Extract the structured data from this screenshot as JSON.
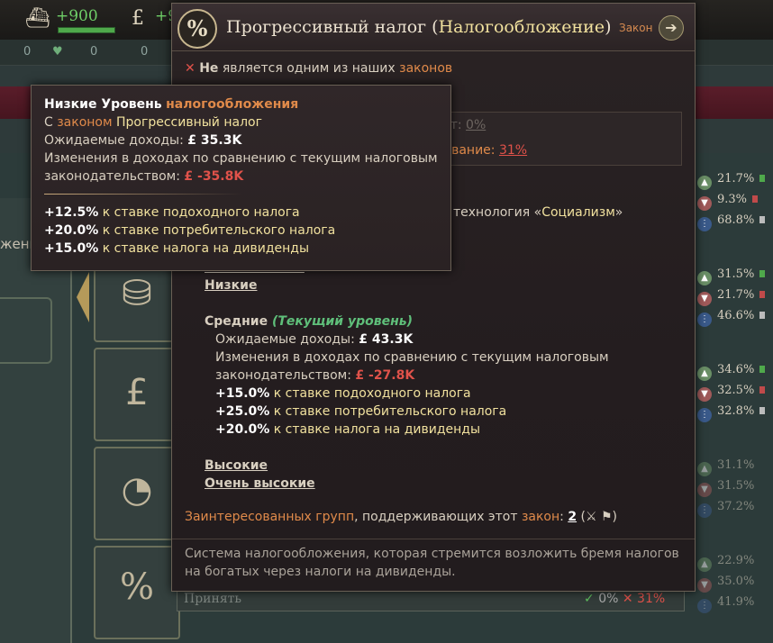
{
  "topbar": {
    "income": "+900",
    "second_value": "+9"
  },
  "subbar": {
    "stat1": "0",
    "stat2": "0",
    "stat3": "0",
    "stat4": "0"
  },
  "left_panel": {
    "partial_text": "жени"
  },
  "votes": [
    {
      "yes": "21.7%",
      "no": "9.3%",
      "abstain": "68.8%"
    },
    {
      "yes": "31.5%",
      "no": "21.7%",
      "abstain": "46.6%"
    },
    {
      "yes": "34.6%",
      "no": "32.5%",
      "abstain": "32.8%"
    },
    {
      "yes": "31.1%",
      "no": "31.5%",
      "abstain": "37.2%"
    },
    {
      "yes": "22.9%",
      "no": "35.0%",
      "abstain": "41.9%"
    }
  ],
  "bottom": {
    "accept_label": "Принять",
    "yes_pct": "0%",
    "no_pct": "31%"
  },
  "law": {
    "icon": "%",
    "name": "Прогрессивный налог",
    "group": "Налогообложение",
    "type_label": "Закон",
    "not_prefix": "Не",
    "not_middle": "является одним из наших",
    "not_link": "законов",
    "underbox_line1_pre": "ст:",
    "underbox_line1_val": "0%",
    "underbox_line2_pre": "ивание:",
    "underbox_line2_val": "31%",
    "tech_pre": "технология «",
    "tech_name": "Социализм",
    "tech_post": "»"
  },
  "levels": {
    "very_low_partial": "Очень низкие",
    "low": "Низкие",
    "medium": "Средние",
    "current_tag": "(Текущий уровень)",
    "expected_label": "Ожидаемые доходы:",
    "expected_value": "£ 43.3K",
    "change_label1": "Изменения в доходах по сравнению с текущим налоговым",
    "change_label2": "законодательством:",
    "change_value": "£ -27.8K",
    "rates": [
      {
        "value": "+15.0%",
        "text": "к ставке подоходного налога"
      },
      {
        "value": "+25.0%",
        "text": "к ставке потребительского налога"
      },
      {
        "value": "+20.0%",
        "text": "к ставке налога на дивиденды"
      }
    ],
    "high": "Высокие",
    "very_high": "Очень высокие"
  },
  "igs": {
    "pre": "Заинтересованных групп",
    "mid": ", поддерживающих этот ",
    "law_word": "закон",
    "colon": ":",
    "count": "2",
    "icons": "(⚔ ⚑)"
  },
  "description": "Система налогообложения, которая стремится возложить бремя налогов на богатых через налоги на дивиденды.",
  "small_tip": {
    "title_pre": "Низкие Уровень",
    "title_link": "налогообложения",
    "with_pre": "С",
    "with_link": "законом",
    "with_name": "Прогрессивный налог",
    "expected_label": "Ожидаемые доходы:",
    "expected_value": "£ 35.3K",
    "change_label1": "Изменения в доходах по сравнению с текущим налоговым",
    "change_label2": "законодательством:",
    "change_value": "£ -35.8K",
    "rates": [
      {
        "value": "+12.5%",
        "text": "к ставке подоходного налога"
      },
      {
        "value": "+20.0%",
        "text": "к ставке потребительского налога"
      },
      {
        "value": "+15.0%",
        "text": "к ставке налога на дивиденды"
      }
    ]
  }
}
